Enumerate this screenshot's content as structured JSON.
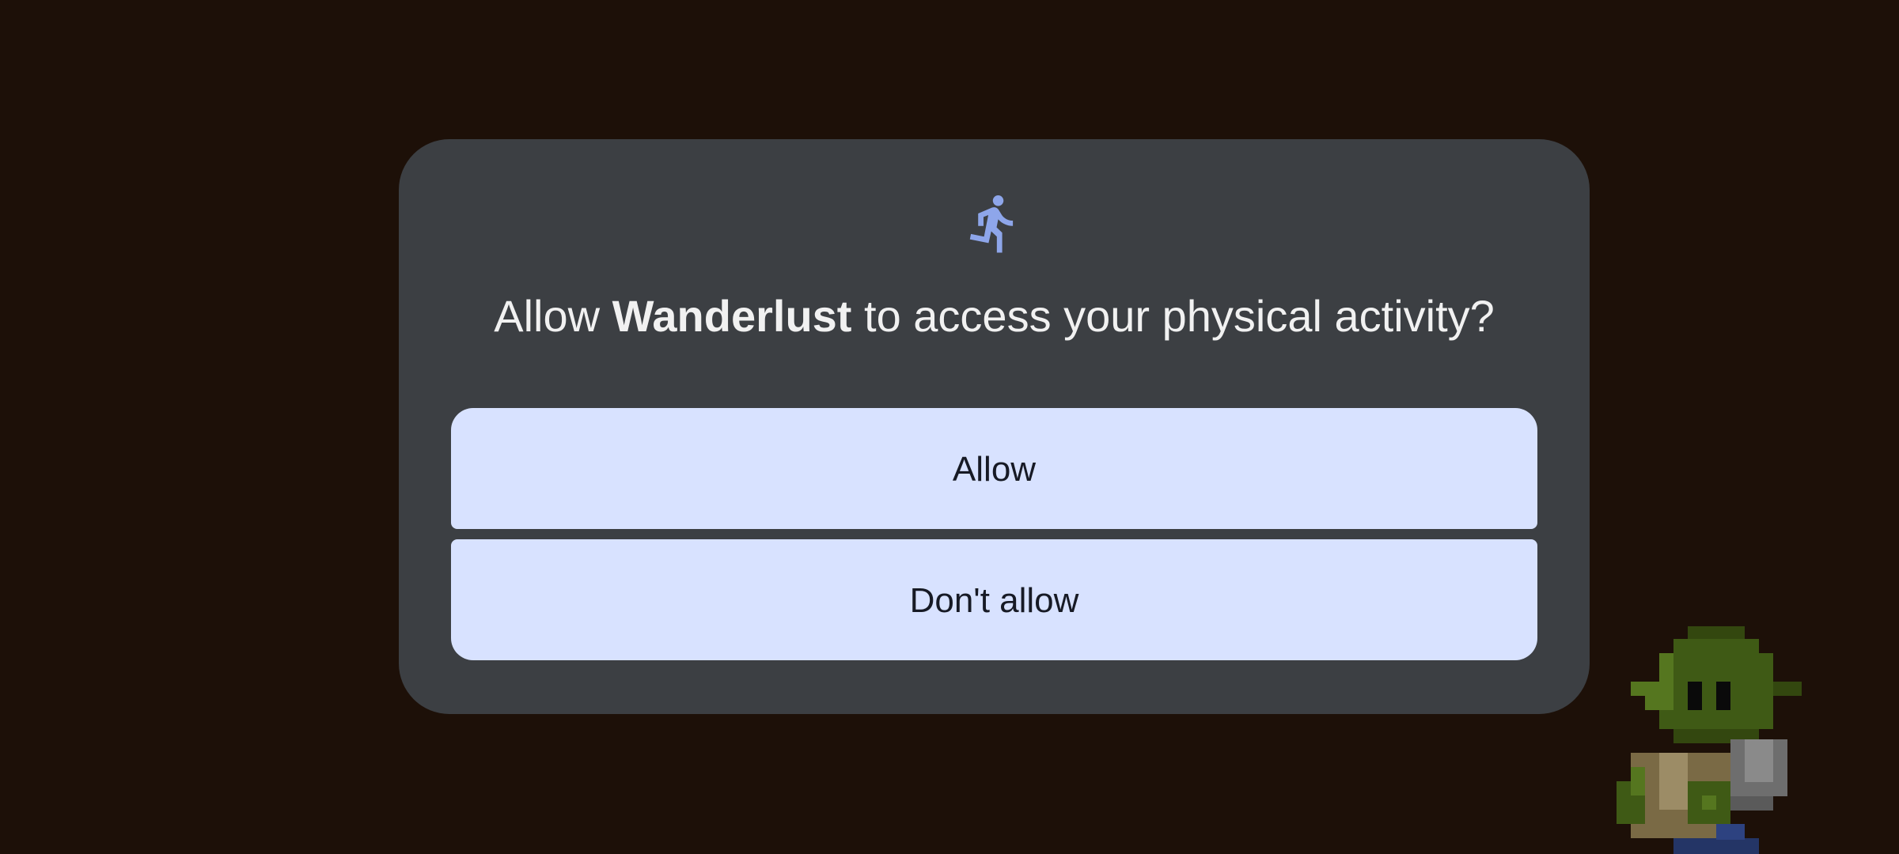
{
  "dialog": {
    "icon": "running-person-icon",
    "title_prefix": "Allow ",
    "app_name": "Wanderlust",
    "title_suffix": " to access your physical activity?",
    "allow_label": "Allow",
    "deny_label": "Don't allow"
  },
  "background": {
    "sprite": "goblin-sprite"
  },
  "colors": {
    "background": "#1d1008",
    "dialog": "#3c3f43",
    "button": "#d8e2ff",
    "button_text": "#171a25",
    "icon": "#8ea6ea",
    "title_text": "#f1f1f1"
  }
}
